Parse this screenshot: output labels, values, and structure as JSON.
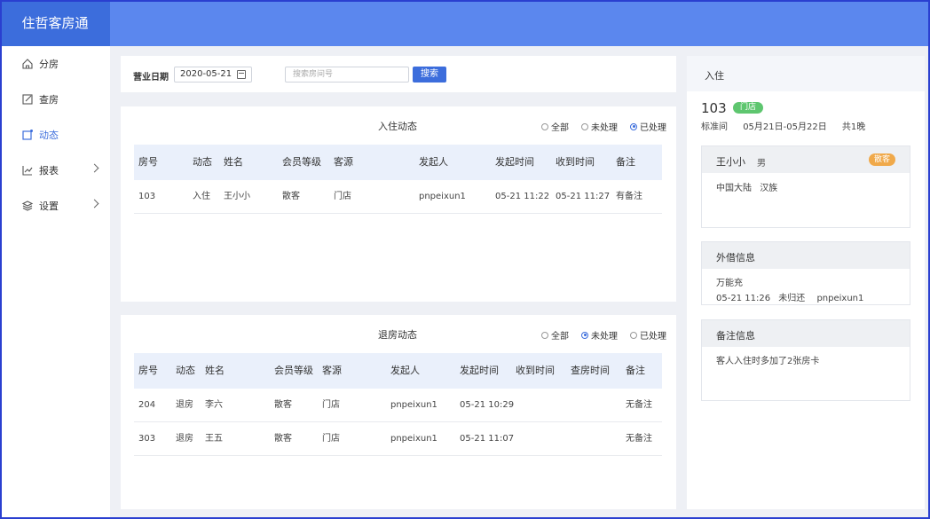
{
  "app": {
    "title": "住哲客房通"
  },
  "sidebar": {
    "items": [
      {
        "label": "分房",
        "icon": "home-icon",
        "active": false,
        "has_arrow": false
      },
      {
        "label": "查房",
        "icon": "edit-icon",
        "active": false,
        "has_arrow": false
      },
      {
        "label": "动态",
        "icon": "notification-icon",
        "active": true,
        "has_arrow": false
      },
      {
        "label": "报表",
        "icon": "chart-icon",
        "active": false,
        "has_arrow": true
      },
      {
        "label": "设置",
        "icon": "layers-icon",
        "active": false,
        "has_arrow": true
      }
    ]
  },
  "filter": {
    "date_label": "营业日期",
    "date_value": "2020-05-21",
    "search_placeholder": "搜索房间号",
    "search_button": "搜索"
  },
  "checkin_panel": {
    "title": "入住动态",
    "radio": [
      "全部",
      "未处理",
      "已处理"
    ],
    "radio_selected": "已处理",
    "headers": [
      "房号",
      "动态",
      "姓名",
      "会员等级",
      "客源",
      "发起人",
      "发起时间",
      "收到时间",
      "备注"
    ],
    "rows": [
      [
        "103",
        "入住",
        "王小小",
        "散客",
        "门店",
        "pnpeixun1",
        "05-21 11:22",
        "05-21 11:27",
        "有备注"
      ]
    ]
  },
  "checkout_panel": {
    "title": "退房动态",
    "radio": [
      "全部",
      "未处理",
      "已处理"
    ],
    "radio_selected": "未处理",
    "headers": [
      "房号",
      "动态",
      "姓名",
      "会员等级",
      "客源",
      "发起人",
      "发起时间",
      "收到时间",
      "查房时间",
      "备注"
    ],
    "rows": [
      [
        "204",
        "退房",
        "李六",
        "散客",
        "门店",
        "pnpeixun1",
        "05-21 10:29",
        "",
        "",
        "无备注"
      ],
      [
        "303",
        "退房",
        "王五",
        "散客",
        "门店",
        "pnpeixun1",
        "05-21 11:07",
        "",
        "",
        "无备注"
      ]
    ]
  },
  "detail": {
    "header": "入住",
    "room_no": "103",
    "room_tag": "门店",
    "room_type": "标准间",
    "date_range": "05月21日-05月22日",
    "nights": "共1晚",
    "guest": {
      "name": "王小小",
      "gender": "男",
      "tag": "散客",
      "origin": "中国大陆",
      "ethnicity": "汉族"
    },
    "borrow": {
      "title": "外借信息",
      "item": "万能充",
      "time": "05-21 11:26",
      "status": "未归还",
      "operator": "pnpeixun1"
    },
    "remark": {
      "title": "备注信息",
      "text": "客人入住时多加了2张房卡"
    }
  },
  "colors": {
    "header": "#5b87ee",
    "logo_bg": "#3c6ddc",
    "primary": "#3c6ddc",
    "tag_green": "#5ec66f",
    "tag_orange": "#f0a94a"
  }
}
